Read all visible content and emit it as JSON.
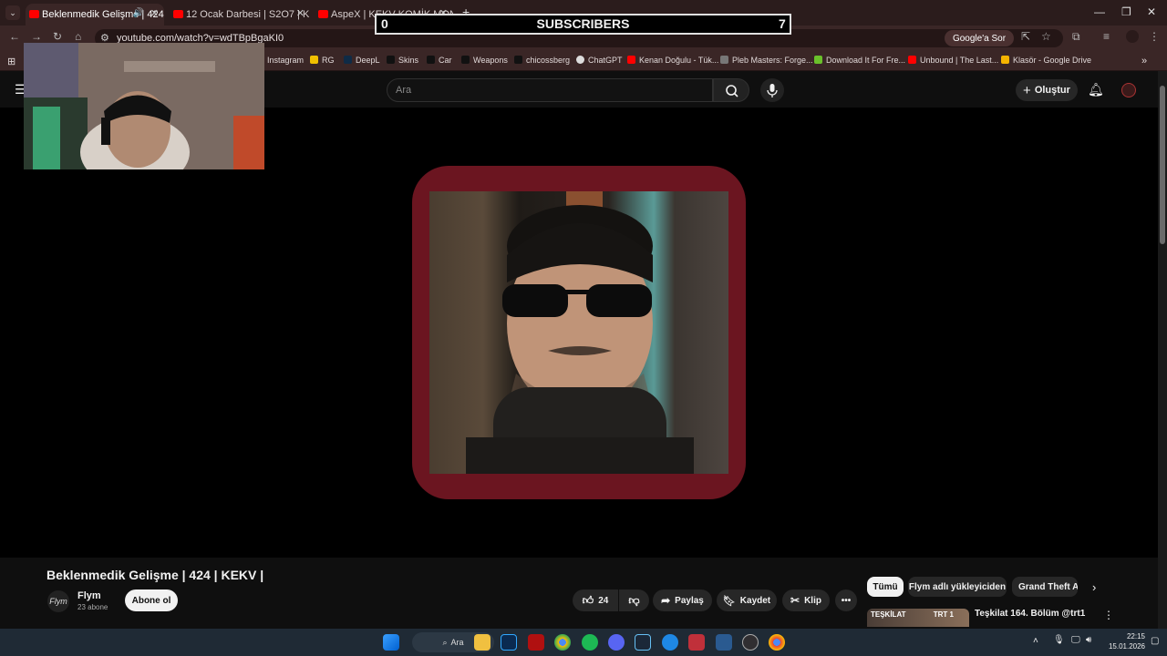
{
  "browser": {
    "tabs": [
      {
        "title": "Beklenmedik Gelişme | 424",
        "active": true
      },
      {
        "title": "12 Ocak Darbesi | S2O7 | KEKV",
        "active": false
      },
      {
        "title": "AspeX | KEKV KOMİK MONTAJ RG",
        "active": false
      }
    ],
    "new_tab": "+",
    "url": "youtube.com/watch?v=wdTBpBgaKI0",
    "google_ask": "Google'a Sor",
    "bookmarks": [
      "Instagram",
      "RG",
      "DeepL",
      "Skins",
      "Car",
      "Weapons",
      "chicossberg",
      "ChatGPT",
      "Kenan Doğulu - Tük...",
      "Pleb Masters: Forge...",
      "Download It For Fre...",
      "Unbound | The Last...",
      "Klasör - Google Drive"
    ]
  },
  "overlay": {
    "left_count": "0",
    "title": "SUBSCRIBERS",
    "right_count": "7"
  },
  "youtube": {
    "search_placeholder": "Ara",
    "create_label": "Oluştur",
    "video_title": "Beklenmedik Gelişme | 424 | KEKV |",
    "channel_logo_text": "Flym",
    "channel_name": "Flym",
    "channel_subs": "23 abone",
    "subscribe_label": "Abone ol",
    "like_count": "24",
    "share_label": "Paylaş",
    "save_label": "Kaydet",
    "clip_label": "Klip",
    "more_label": "•••",
    "chips": [
      "Tümü",
      "Flym adlı yükleyiciden",
      "Grand Theft Auto"
    ],
    "recommended": {
      "thumb_text": "TEŞKİLAT",
      "badge": "TRT 1",
      "title": "Teşkilat 164. Bölüm @trt1"
    }
  },
  "taskbar": {
    "search_label": "Ara",
    "time": "22:15",
    "date": "15.01.2026"
  },
  "colors": {
    "frame": "#6b1520",
    "yt_red": "#ff0000",
    "chrome_tab": "#3a2626"
  }
}
